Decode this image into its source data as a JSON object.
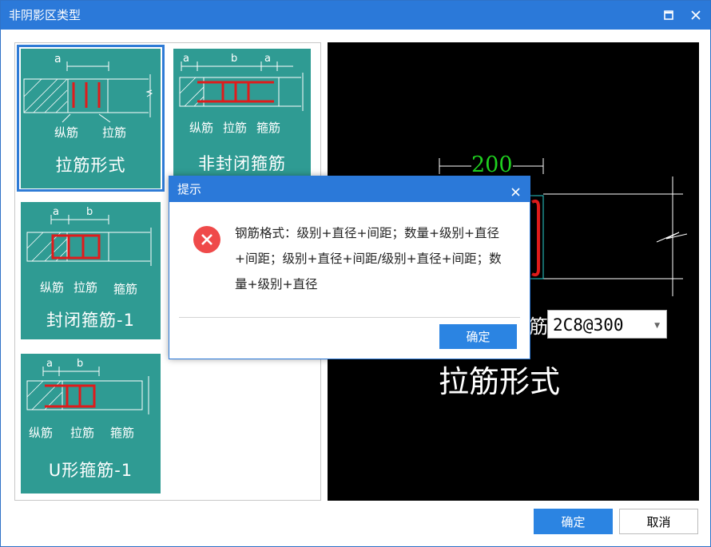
{
  "window": {
    "title": "非阴影区类型",
    "maximize_icon": "maximize-icon",
    "close_icon": "close-icon"
  },
  "tiles": [
    {
      "id": "tie-bar",
      "label": "拉筋形式",
      "sub": [
        "纵筋",
        "拉筋"
      ],
      "dim": "a",
      "selected": true
    },
    {
      "id": "open-stirrup",
      "label": "非封闭箍筋",
      "sub": [
        "纵筋",
        "拉筋",
        "箍筋"
      ],
      "dims": [
        "a",
        "b",
        "a"
      ],
      "selected": false
    },
    {
      "id": "closed-stirrup-1",
      "label": "封闭箍筋-1",
      "sub": [
        "纵筋",
        "拉筋",
        "箍筋"
      ],
      "dims": [
        "a",
        "b"
      ],
      "selected": false
    },
    {
      "id": "u-stirrup-1",
      "label": "U形箍筋-1",
      "sub": [
        "纵筋",
        "拉筋",
        "箍筋"
      ],
      "dims": [
        "a",
        "b"
      ],
      "selected": false
    }
  ],
  "preview": {
    "dimension": "200",
    "label_fragment": "筋",
    "combo_value": "2C8@300",
    "big_label": "拉筋形式"
  },
  "buttons": {
    "ok": "确定",
    "cancel": "取消"
  },
  "dialog": {
    "title": "提示",
    "message": "钢筋格式：级别+直径+间距；数量+级别+直径+间距；级别+直径+间距/级别+直径+间距；数量+级别+直径",
    "ok": "确定",
    "icon": "error-icon"
  },
  "colors": {
    "titlebar": "#2b79d9",
    "tile": "#2f9b93",
    "rebar": "#e01b1b",
    "dim_green": "#1fd01f",
    "button": "#2b84e2"
  }
}
